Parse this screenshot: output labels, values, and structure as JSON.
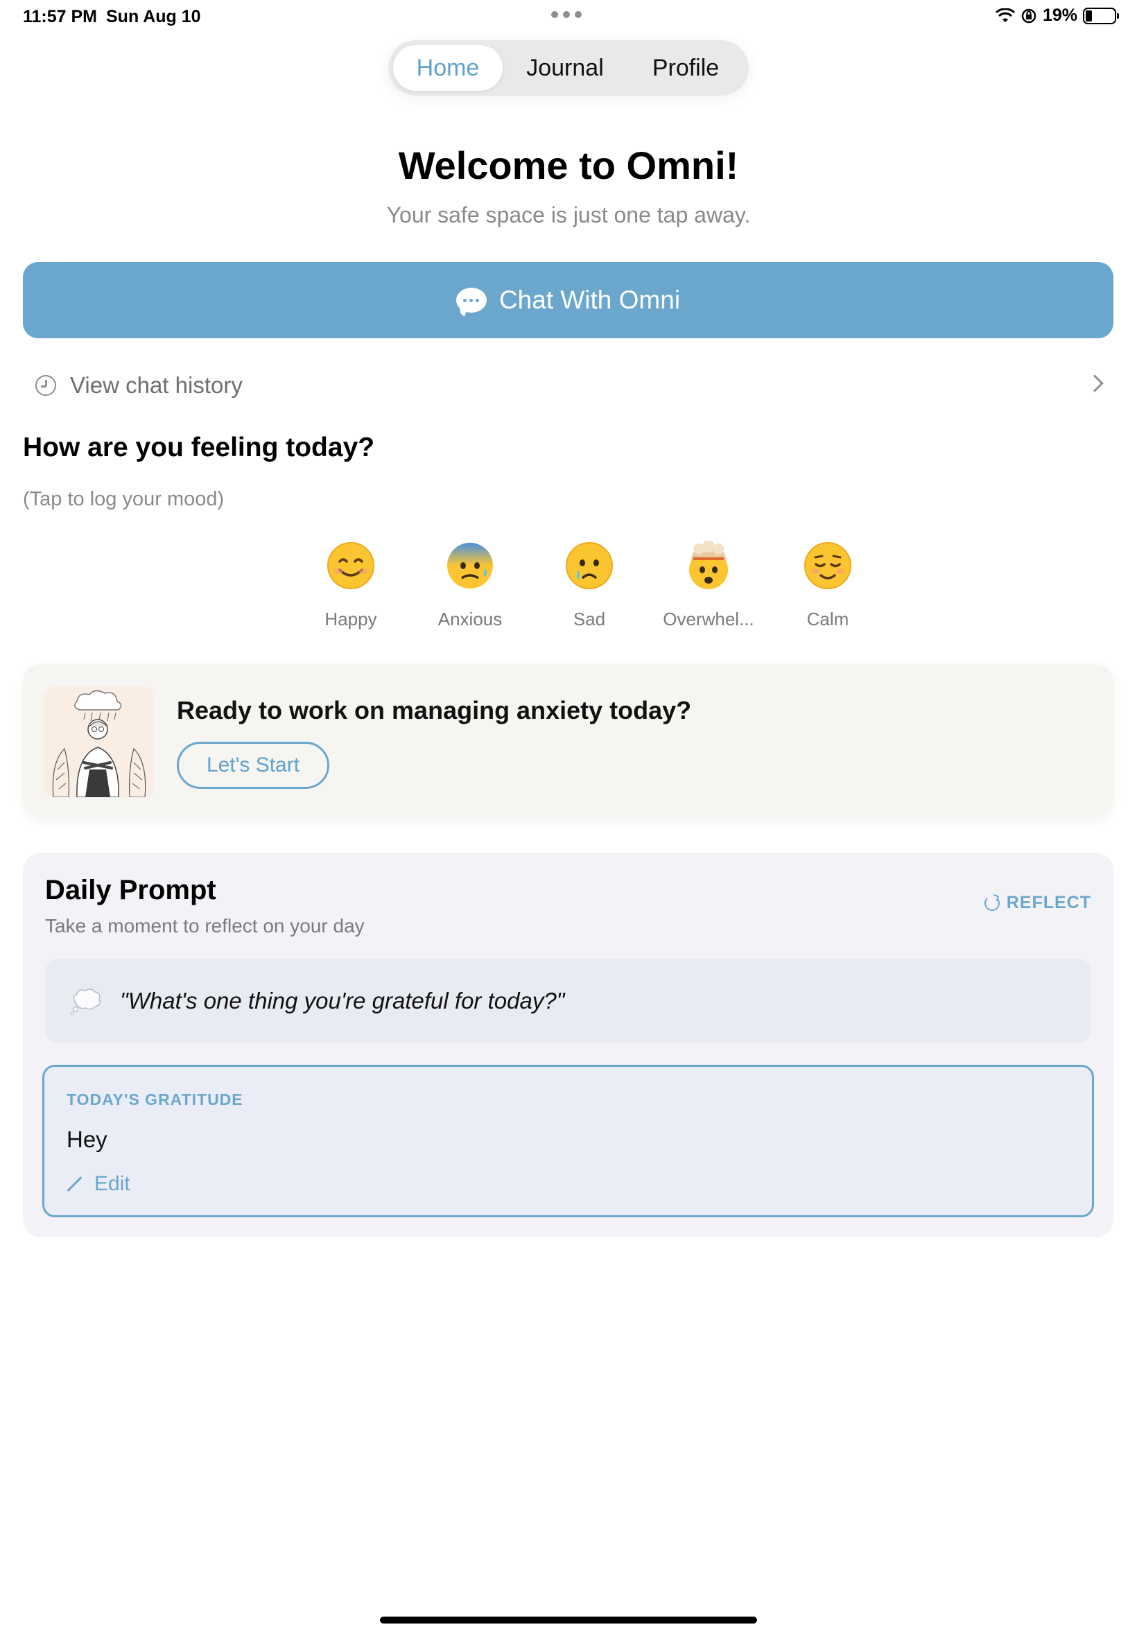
{
  "status_bar": {
    "time": "11:57 PM",
    "date": "Sun Aug 10",
    "battery": "19%",
    "battery_level": 0.19
  },
  "tabs": [
    {
      "label": "Home",
      "selected": true
    },
    {
      "label": "Journal",
      "selected": false
    },
    {
      "label": "Profile",
      "selected": false
    }
  ],
  "header": {
    "title": "Welcome to Omni!",
    "subtitle": "Your safe space is just one tap away."
  },
  "chat_button": {
    "label": "Chat With Omni",
    "icon": "speech-bubble-icon"
  },
  "history": {
    "label": "View chat history",
    "icon": "clock-icon"
  },
  "mood": {
    "title": "How are you feeling today?",
    "subtitle": "(Tap to log your mood)",
    "items": [
      {
        "label": "Happy",
        "icon": "smiling-face-icon"
      },
      {
        "label": "Anxious",
        "icon": "anxious-face-icon"
      },
      {
        "label": "Sad",
        "icon": "crying-face-icon"
      },
      {
        "label": "Overwhel...",
        "icon": "exploding-head-icon"
      },
      {
        "label": "Calm",
        "icon": "relieved-face-icon"
      }
    ]
  },
  "anxiety_card": {
    "title": "Ready to work on managing anxiety today?",
    "button": "Let's Start"
  },
  "daily_prompt": {
    "title": "Daily Prompt",
    "subtitle": "Take a moment to reflect on your day",
    "reflect_label": "REFLECT",
    "prompt": "\"What's one thing you're grateful for today?\"",
    "gratitude_label": "TODAY'S GRATITUDE",
    "gratitude_text": "Hey",
    "edit_label": "Edit"
  },
  "colors": {
    "accent": "#6ba7cd",
    "card_bg": "#f3f3f7",
    "anxiety_card_bg": "#f7f5f1"
  }
}
